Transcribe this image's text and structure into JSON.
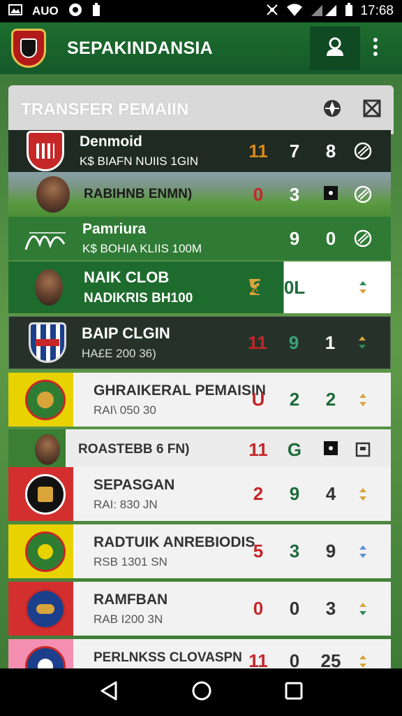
{
  "status_bar": {
    "left_text": "AUO",
    "time": "17:68",
    "icons": [
      "gallery-icon",
      "circle-icon",
      "battery-small-icon",
      "mute-icon",
      "wifi-icon",
      "signal-icon",
      "battery-icon"
    ]
  },
  "app_bar": {
    "title": "SEPAKINDANSIA",
    "icons": [
      "club-logo",
      "profile-icon",
      "more-vert-icon"
    ]
  },
  "panel": {
    "title": "TRANSFER PEMAIIN",
    "icons": [
      "compass-icon",
      "close-box-icon"
    ]
  },
  "rows": [
    {
      "name": "Denmoid",
      "sub": "K$ BIAFN NUIIS 1GIN",
      "stats": [
        "11",
        "7",
        "8"
      ],
      "end_icon": "ball-icon",
      "style": "dark-stripe"
    },
    {
      "name": "RABIHNB ENMN)",
      "sub": "",
      "stats": [
        "0",
        "3",
        ""
      ],
      "end_icon": "ball-icon",
      "style": "stadium"
    },
    {
      "name": "Pamriura",
      "sub": "K$ BOHIA KLIIS 100M",
      "stats": [
        "",
        "9",
        "0"
      ],
      "end_icon": "ball-icon",
      "style": "green"
    },
    {
      "name": "NAIK CLOB",
      "sub": "NADIKRIS BH100",
      "stats": [
        "3",
        "0L",
        ""
      ],
      "end_icon": "arrows-icon",
      "style": "green-white"
    },
    {
      "name": "BAIP CLGIN",
      "sub": "HA£E 200 36)",
      "stats": [
        "11",
        "9",
        "1"
      ],
      "end_icon": "arrows-icon",
      "style": "dark"
    },
    {
      "name": "GHRAIKERAL PEMAISIN",
      "sub": "RAI\\ 050 30",
      "stats": [
        "U",
        "2",
        "2"
      ],
      "end_icon": "arrows-icon",
      "style": "light"
    },
    {
      "name": "ROASTEBB 6 FN)",
      "sub": "",
      "stats": [
        "11",
        "G",
        ""
      ],
      "end_icon": "square-icon",
      "style": "grass"
    },
    {
      "name": "SEPASGAN",
      "sub": "RAI: 830 JN",
      "stats": [
        "2",
        "9",
        "4"
      ],
      "end_icon": "arrows-icon",
      "style": "light"
    },
    {
      "name": "RADTUIK ANREBIODIS",
      "sub": "RSB 1301 SN",
      "stats": [
        "5",
        "3",
        "9"
      ],
      "end_icon": "arrows-icon",
      "style": "light"
    },
    {
      "name": "RAMFBAN",
      "sub": "RAB I200 3N",
      "stats": [
        "0",
        "0",
        "3"
      ],
      "end_icon": "arrows-icon",
      "style": "light"
    },
    {
      "name": "PERLNKSS CLOVASPN",
      "sub": "",
      "stats": [
        "11",
        "0",
        "25"
      ],
      "end_icon": "arrows-icon",
      "style": "light"
    }
  ],
  "colors": {
    "primary_green": "#1d6e2e",
    "accent_red": "#c4262a",
    "dark_row": "#263229"
  },
  "nav_bar": {
    "icons": [
      "back-icon",
      "home-icon",
      "recents-icon"
    ]
  }
}
